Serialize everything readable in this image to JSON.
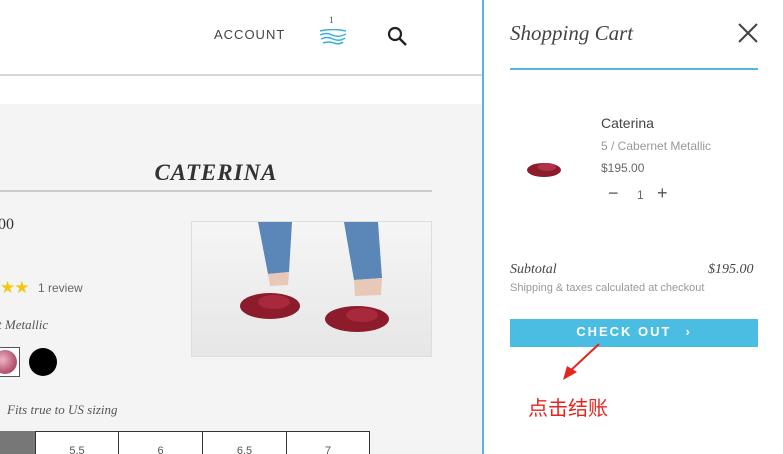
{
  "nav": {
    "account": "ACCOUNT",
    "cart_count": "1"
  },
  "product": {
    "title": "CATERINA",
    "price_fragment": "00",
    "stars": "★★",
    "review_text": "1 review",
    "color_fragment": "t Metallic",
    "fit_note": "Fits true to US sizing",
    "sizes": [
      "5.5",
      "6",
      "6.5",
      "7"
    ]
  },
  "cart": {
    "title": "Shopping Cart",
    "item": {
      "name": "Caterina",
      "variant": "5 / Cabernet Metallic",
      "price": "$195.00",
      "quantity": "1",
      "minus": "−",
      "plus": "+"
    },
    "subtotal_label": "Subtotal",
    "subtotal_value": "$195.00",
    "shipping_note": "Shipping & taxes calculated at checkout",
    "checkout_label": "CHECK OUT",
    "checkout_chevron": "›"
  },
  "annotation": {
    "text": "点击结账"
  },
  "colors": {
    "accent": "#4bbde3",
    "annotation": "#e5261f",
    "star": "#f3c80c"
  }
}
